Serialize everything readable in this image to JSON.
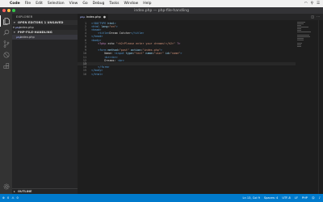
{
  "menubar": {
    "apple_icon": "apple-icon",
    "app": "Code",
    "items": [
      "File",
      "Edit",
      "Selection",
      "View",
      "Go",
      "Debug",
      "Tasks",
      "Window",
      "Help"
    ]
  },
  "window": {
    "title": "index.php — php-file-handling"
  },
  "sidebar": {
    "title": "EXPLORER",
    "open_editors": {
      "label": "OPEN EDITORS 1 UNSAVED",
      "files": [
        {
          "name": "index.php"
        }
      ]
    },
    "project": {
      "label": "PHP-FILE-HANDLING",
      "files": [
        {
          "name": "index.php"
        }
      ]
    },
    "outline": "OUTLINE"
  },
  "editor": {
    "tab": {
      "name": "index.php"
    },
    "current_line": 13
  },
  "statusbar": {
    "errors": "0",
    "warnings": "0",
    "position": "Ln 13, Col 9",
    "spaces": "Spaces: 4",
    "encoding": "UTF-8",
    "eol": "LF",
    "language": "PHP"
  },
  "colors": {
    "statusbar": "#007acc",
    "editor_bg": "#1e1e1e",
    "sidebar_bg": "#252526",
    "activity_bg": "#333333"
  }
}
